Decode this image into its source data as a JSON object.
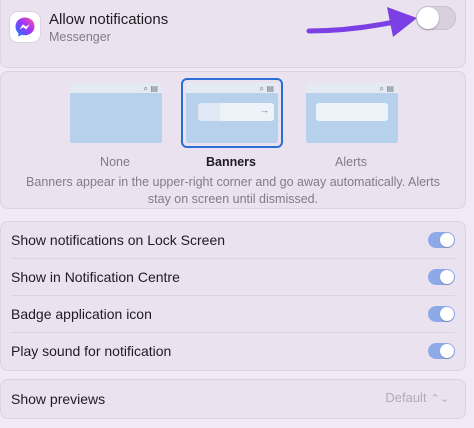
{
  "header": {
    "title": "Allow notifications",
    "subtitle": "Messenger",
    "app_icon": "messenger-icon",
    "toggle_on": false
  },
  "alert_style": {
    "options": [
      {
        "label": "None",
        "selected": false
      },
      {
        "label": "Banners",
        "selected": true
      },
      {
        "label": "Alerts",
        "selected": false
      }
    ],
    "description": "Banners appear in the upper-right corner and go away automatically. Alerts stay on screen until dismissed."
  },
  "settings": [
    {
      "label": "Show notifications on Lock Screen",
      "on": true
    },
    {
      "label": "Show in Notification Centre",
      "on": true
    },
    {
      "label": "Badge application icon",
      "on": true
    },
    {
      "label": "Play sound for notification",
      "on": true
    }
  ],
  "previews": {
    "label": "Show previews",
    "value": "Default"
  },
  "colors": {
    "accent": "#2a6fd6",
    "toggle_on": "#8ea9e8",
    "annotation_arrow": "#7b3fe4"
  }
}
